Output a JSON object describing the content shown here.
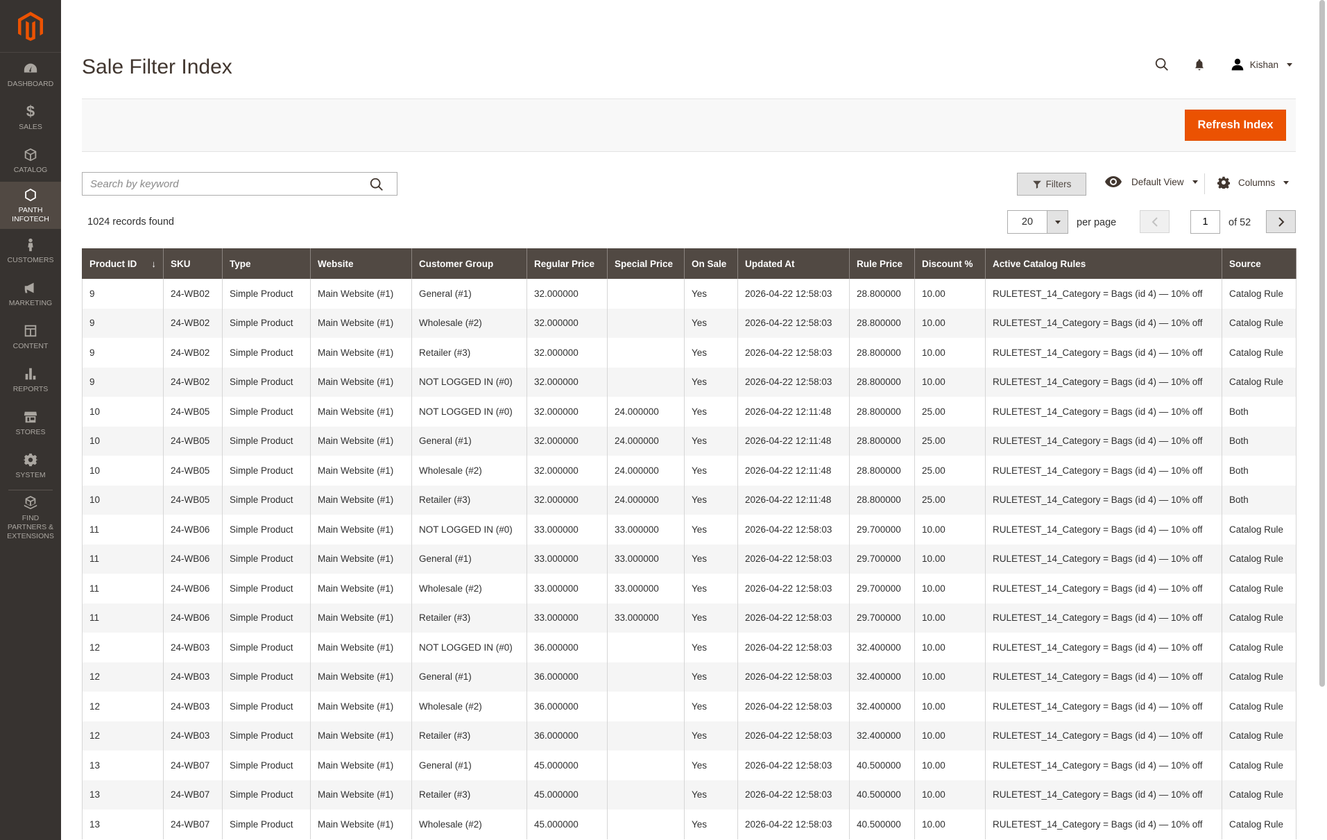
{
  "sidebar": {
    "items": [
      {
        "label": "DASHBOARD",
        "icon": "dashboard-icon"
      },
      {
        "label": "$",
        "icon": "dollar-icon",
        "text": "SALES"
      },
      {
        "label": "CATALOG",
        "icon": "cube-icon"
      },
      {
        "label": "PANTH INFOTECH",
        "icon": "hexagon-icon"
      },
      {
        "label": "CUSTOMERS",
        "icon": "person-icon"
      },
      {
        "label": "MARKETING",
        "icon": "megaphone-icon"
      },
      {
        "label": "CONTENT",
        "icon": "layout-icon"
      },
      {
        "label": "REPORTS",
        "icon": "bar-chart-icon"
      },
      {
        "label": "STORES",
        "icon": "store-icon"
      },
      {
        "label": "SYSTEM",
        "icon": "gear-icon"
      },
      {
        "label": "FIND PARTNERS & EXTENSIONS",
        "icon": "boxes-icon"
      }
    ],
    "sales_label": "SALES"
  },
  "header": {
    "title": "Sale Filter Index",
    "user": "Kishan"
  },
  "actions": {
    "refresh_label": "Refresh Index"
  },
  "toolbar": {
    "search_placeholder": "Search by keyword",
    "filters_label": "Filters",
    "view_label": "Default View",
    "columns_label": "Columns",
    "records_found": "1024 records found",
    "per_page_value": "20",
    "per_page_label": "per page",
    "current_page": "1",
    "of_pages": "of 52"
  },
  "grid": {
    "columns": [
      "Product ID",
      "SKU",
      "Type",
      "Website",
      "Customer Group",
      "Regular Price",
      "Special Price",
      "On Sale",
      "Updated At",
      "Rule Price",
      "Discount %",
      "Active Catalog Rules",
      "Source"
    ],
    "rows": [
      [
        "9",
        "24-WB02",
        "Simple Product",
        "Main Website (#1)",
        "General (#1)",
        "32.000000",
        "",
        "Yes",
        "2026-04-22 12:58:03",
        "28.800000",
        "10.00",
        "RULETEST_14_Category = Bags (id 4) — 10% off",
        "Catalog Rule"
      ],
      [
        "9",
        "24-WB02",
        "Simple Product",
        "Main Website (#1)",
        "Wholesale (#2)",
        "32.000000",
        "",
        "Yes",
        "2026-04-22 12:58:03",
        "28.800000",
        "10.00",
        "RULETEST_14_Category = Bags (id 4) — 10% off",
        "Catalog Rule"
      ],
      [
        "9",
        "24-WB02",
        "Simple Product",
        "Main Website (#1)",
        "Retailer (#3)",
        "32.000000",
        "",
        "Yes",
        "2026-04-22 12:58:03",
        "28.800000",
        "10.00",
        "RULETEST_14_Category = Bags (id 4) — 10% off",
        "Catalog Rule"
      ],
      [
        "9",
        "24-WB02",
        "Simple Product",
        "Main Website (#1)",
        "NOT LOGGED IN (#0)",
        "32.000000",
        "",
        "Yes",
        "2026-04-22 12:58:03",
        "28.800000",
        "10.00",
        "RULETEST_14_Category = Bags (id 4) — 10% off",
        "Catalog Rule"
      ],
      [
        "10",
        "24-WB05",
        "Simple Product",
        "Main Website (#1)",
        "NOT LOGGED IN (#0)",
        "32.000000",
        "24.000000",
        "Yes",
        "2026-04-22 12:11:48",
        "28.800000",
        "25.00",
        "RULETEST_14_Category = Bags (id 4) — 10% off",
        "Both"
      ],
      [
        "10",
        "24-WB05",
        "Simple Product",
        "Main Website (#1)",
        "General (#1)",
        "32.000000",
        "24.000000",
        "Yes",
        "2026-04-22 12:11:48",
        "28.800000",
        "25.00",
        "RULETEST_14_Category = Bags (id 4) — 10% off",
        "Both"
      ],
      [
        "10",
        "24-WB05",
        "Simple Product",
        "Main Website (#1)",
        "Wholesale (#2)",
        "32.000000",
        "24.000000",
        "Yes",
        "2026-04-22 12:11:48",
        "28.800000",
        "25.00",
        "RULETEST_14_Category = Bags (id 4) — 10% off",
        "Both"
      ],
      [
        "10",
        "24-WB05",
        "Simple Product",
        "Main Website (#1)",
        "Retailer (#3)",
        "32.000000",
        "24.000000",
        "Yes",
        "2026-04-22 12:11:48",
        "28.800000",
        "25.00",
        "RULETEST_14_Category = Bags (id 4) — 10% off",
        "Both"
      ],
      [
        "11",
        "24-WB06",
        "Simple Product",
        "Main Website (#1)",
        "NOT LOGGED IN (#0)",
        "33.000000",
        "33.000000",
        "Yes",
        "2026-04-22 12:58:03",
        "29.700000",
        "10.00",
        "RULETEST_14_Category = Bags (id 4) — 10% off",
        "Catalog Rule"
      ],
      [
        "11",
        "24-WB06",
        "Simple Product",
        "Main Website (#1)",
        "General (#1)",
        "33.000000",
        "33.000000",
        "Yes",
        "2026-04-22 12:58:03",
        "29.700000",
        "10.00",
        "RULETEST_14_Category = Bags (id 4) — 10% off",
        "Catalog Rule"
      ],
      [
        "11",
        "24-WB06",
        "Simple Product",
        "Main Website (#1)",
        "Wholesale (#2)",
        "33.000000",
        "33.000000",
        "Yes",
        "2026-04-22 12:58:03",
        "29.700000",
        "10.00",
        "RULETEST_14_Category = Bags (id 4) — 10% off",
        "Catalog Rule"
      ],
      [
        "11",
        "24-WB06",
        "Simple Product",
        "Main Website (#1)",
        "Retailer (#3)",
        "33.000000",
        "33.000000",
        "Yes",
        "2026-04-22 12:58:03",
        "29.700000",
        "10.00",
        "RULETEST_14_Category = Bags (id 4) — 10% off",
        "Catalog Rule"
      ],
      [
        "12",
        "24-WB03",
        "Simple Product",
        "Main Website (#1)",
        "NOT LOGGED IN (#0)",
        "36.000000",
        "",
        "Yes",
        "2026-04-22 12:58:03",
        "32.400000",
        "10.00",
        "RULETEST_14_Category = Bags (id 4) — 10% off",
        "Catalog Rule"
      ],
      [
        "12",
        "24-WB03",
        "Simple Product",
        "Main Website (#1)",
        "General (#1)",
        "36.000000",
        "",
        "Yes",
        "2026-04-22 12:58:03",
        "32.400000",
        "10.00",
        "RULETEST_14_Category = Bags (id 4) — 10% off",
        "Catalog Rule"
      ],
      [
        "12",
        "24-WB03",
        "Simple Product",
        "Main Website (#1)",
        "Wholesale (#2)",
        "36.000000",
        "",
        "Yes",
        "2026-04-22 12:58:03",
        "32.400000",
        "10.00",
        "RULETEST_14_Category = Bags (id 4) — 10% off",
        "Catalog Rule"
      ],
      [
        "12",
        "24-WB03",
        "Simple Product",
        "Main Website (#1)",
        "Retailer (#3)",
        "36.000000",
        "",
        "Yes",
        "2026-04-22 12:58:03",
        "32.400000",
        "10.00",
        "RULETEST_14_Category = Bags (id 4) — 10% off",
        "Catalog Rule"
      ],
      [
        "13",
        "24-WB07",
        "Simple Product",
        "Main Website (#1)",
        "General (#1)",
        "45.000000",
        "",
        "Yes",
        "2026-04-22 12:58:03",
        "40.500000",
        "10.00",
        "RULETEST_14_Category = Bags (id 4) — 10% off",
        "Catalog Rule"
      ],
      [
        "13",
        "24-WB07",
        "Simple Product",
        "Main Website (#1)",
        "Retailer (#3)",
        "45.000000",
        "",
        "Yes",
        "2026-04-22 12:58:03",
        "40.500000",
        "10.00",
        "RULETEST_14_Category = Bags (id 4) — 10% off",
        "Catalog Rule"
      ],
      [
        "13",
        "24-WB07",
        "Simple Product",
        "Main Website (#1)",
        "Wholesale (#2)",
        "45.000000",
        "",
        "Yes",
        "2026-04-22 12:58:03",
        "40.500000",
        "10.00",
        "RULETEST_14_Category = Bags (id 4) — 10% off",
        "Catalog Rule"
      ]
    ]
  },
  "colors": {
    "sidebar_bg": "#373330",
    "accent": "#eb5202",
    "header_bg": "#514943"
  }
}
